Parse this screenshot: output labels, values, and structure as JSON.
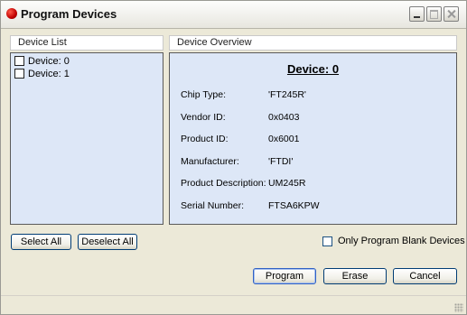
{
  "window": {
    "title": "Program Devices"
  },
  "device_list": {
    "header": "Device List",
    "items": [
      {
        "label": "Device: 0",
        "checked": false
      },
      {
        "label": "Device: 1",
        "checked": false
      }
    ]
  },
  "overview": {
    "header": "Device Overview",
    "title": "Device: 0",
    "fields": [
      {
        "label": "Chip Type:",
        "value": "'FT245R'"
      },
      {
        "label": "Vendor ID:",
        "value": "0x0403"
      },
      {
        "label": "Product ID:",
        "value": "0x6001"
      },
      {
        "label": "Manufacturer:",
        "value": "'FTDI'"
      },
      {
        "label": "Product Description:",
        "value": "UM245R"
      },
      {
        "label": "Serial Number:",
        "value": "FTSA6KPW"
      }
    ]
  },
  "actions": {
    "select_all": "Select All",
    "deselect_all": "Deselect All",
    "only_blank": "Only Program Blank Devices",
    "program": "Program",
    "erase": "Erase",
    "cancel": "Cancel"
  }
}
